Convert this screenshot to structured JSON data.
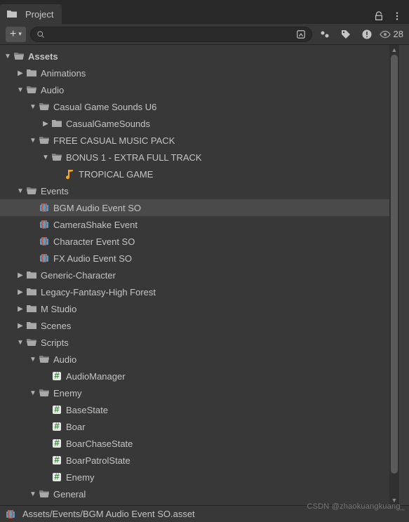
{
  "tab": {
    "title": "Project"
  },
  "toolbar": {
    "add_label": "+",
    "dropdown_marker": "▾",
    "search_placeholder": "",
    "hidden_count": "28"
  },
  "tree": [
    {
      "indent": 0,
      "expand": "open",
      "icon": "folder-open",
      "label": "Assets",
      "selected": false,
      "bold": true
    },
    {
      "indent": 1,
      "expand": "closed",
      "icon": "folder",
      "label": "Animations",
      "selected": false
    },
    {
      "indent": 1,
      "expand": "open",
      "icon": "folder-open",
      "label": "Audio",
      "selected": false
    },
    {
      "indent": 2,
      "expand": "open",
      "icon": "folder-open",
      "label": "Casual Game Sounds U6",
      "selected": false
    },
    {
      "indent": 3,
      "expand": "closed",
      "icon": "folder",
      "label": "CasualGameSounds",
      "selected": false
    },
    {
      "indent": 2,
      "expand": "open",
      "icon": "folder-open",
      "label": "FREE CASUAL MUSIC PACK",
      "selected": false
    },
    {
      "indent": 3,
      "expand": "open",
      "icon": "folder-open",
      "label": "BONUS 1 - EXTRA FULL TRACK",
      "selected": false
    },
    {
      "indent": 4,
      "expand": "none",
      "icon": "audio",
      "label": "TROPICAL GAME",
      "selected": false
    },
    {
      "indent": 1,
      "expand": "open",
      "icon": "folder-open",
      "label": "Events",
      "selected": false
    },
    {
      "indent": 2,
      "expand": "none",
      "icon": "so",
      "label": "BGM Audio Event SO",
      "selected": true
    },
    {
      "indent": 2,
      "expand": "none",
      "icon": "so",
      "label": "CameraShake Event",
      "selected": false
    },
    {
      "indent": 2,
      "expand": "none",
      "icon": "so",
      "label": "Character Event SO",
      "selected": false
    },
    {
      "indent": 2,
      "expand": "none",
      "icon": "so",
      "label": "FX Audio Event SO",
      "selected": false
    },
    {
      "indent": 1,
      "expand": "closed",
      "icon": "folder",
      "label": "Generic-Character",
      "selected": false
    },
    {
      "indent": 1,
      "expand": "closed",
      "icon": "folder",
      "label": "Legacy-Fantasy-High Forest",
      "selected": false
    },
    {
      "indent": 1,
      "expand": "closed",
      "icon": "folder",
      "label": "M Studio",
      "selected": false
    },
    {
      "indent": 1,
      "expand": "closed",
      "icon": "folder",
      "label": "Scenes",
      "selected": false
    },
    {
      "indent": 1,
      "expand": "open",
      "icon": "folder-open",
      "label": "Scripts",
      "selected": false
    },
    {
      "indent": 2,
      "expand": "open",
      "icon": "folder-open",
      "label": "Audio",
      "selected": false
    },
    {
      "indent": 3,
      "expand": "none",
      "icon": "cs",
      "label": "AudioManager",
      "selected": false
    },
    {
      "indent": 2,
      "expand": "open",
      "icon": "folder-open",
      "label": "Enemy",
      "selected": false
    },
    {
      "indent": 3,
      "expand": "none",
      "icon": "cs",
      "label": "BaseState",
      "selected": false
    },
    {
      "indent": 3,
      "expand": "none",
      "icon": "cs",
      "label": "Boar",
      "selected": false
    },
    {
      "indent": 3,
      "expand": "none",
      "icon": "cs",
      "label": "BoarChaseState",
      "selected": false
    },
    {
      "indent": 3,
      "expand": "none",
      "icon": "cs",
      "label": "BoarPatrolState",
      "selected": false
    },
    {
      "indent": 3,
      "expand": "none",
      "icon": "cs",
      "label": "Enemy",
      "selected": false
    },
    {
      "indent": 2,
      "expand": "open",
      "icon": "folder-open",
      "label": "General",
      "selected": false
    }
  ],
  "status": {
    "icon": "so",
    "path": "Assets/Events/BGM Audio Event SO.asset"
  },
  "watermark": "CSDN @zhaokuangkuang_"
}
